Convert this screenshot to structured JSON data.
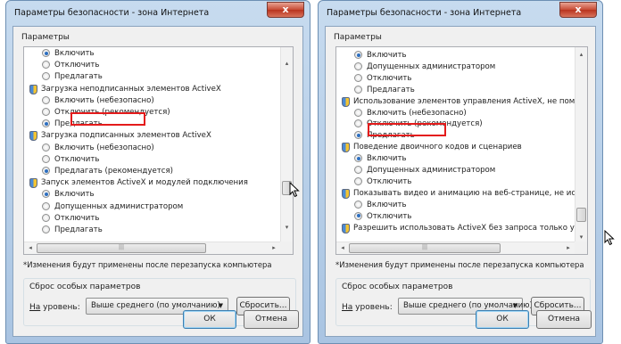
{
  "left_dialog": {
    "title": "Параметры безопасности - зона Интернета",
    "close_label": "x",
    "group_label": "Параметры",
    "items": [
      {
        "kind": "radio",
        "checked": true,
        "label": "Включить"
      },
      {
        "kind": "radio",
        "checked": false,
        "label": "Отключить"
      },
      {
        "kind": "radio",
        "checked": false,
        "label": "Предлагать"
      },
      {
        "kind": "header",
        "label": "Загрузка неподписанных элементов ActiveX"
      },
      {
        "kind": "radio",
        "checked": false,
        "label": "Включить (небезопасно)"
      },
      {
        "kind": "radio",
        "checked": false,
        "label": "Отключить (рекомендуется)"
      },
      {
        "kind": "radio",
        "checked": true,
        "label": "Предлагать"
      },
      {
        "kind": "header",
        "label": "Загрузка подписанных элементов ActiveX"
      },
      {
        "kind": "radio",
        "checked": false,
        "label": "Включить (небезопасно)"
      },
      {
        "kind": "radio",
        "checked": false,
        "label": "Отключить"
      },
      {
        "kind": "radio",
        "checked": true,
        "label": "Предлагать (рекомендуется)"
      },
      {
        "kind": "header",
        "label": "Запуск элементов ActiveX и модулей подключения"
      },
      {
        "kind": "radio",
        "checked": true,
        "label": "Включить"
      },
      {
        "kind": "radio",
        "checked": false,
        "label": "Допущенных администратором"
      },
      {
        "kind": "radio",
        "checked": false,
        "label": "Отключить"
      },
      {
        "kind": "radio",
        "checked": false,
        "label": "Предлагать"
      }
    ],
    "note": "*Изменения будут применены после перезапуска компьютера",
    "reset_group_label": "Сброс особых параметров",
    "level_label_prefix": "На",
    "level_label_rest": " уровень:",
    "level_value": "Выше среднего (по умолчанию)",
    "reset_button": "Сбросить...",
    "ok_button": "ОК",
    "cancel_button": "Отмена"
  },
  "right_dialog": {
    "title": "Параметры безопасности - зона Интернета",
    "close_label": "x",
    "group_label": "Параметры",
    "items": [
      {
        "kind": "radio",
        "checked": true,
        "label": "Включить"
      },
      {
        "kind": "radio",
        "checked": false,
        "label": "Допущенных администратором"
      },
      {
        "kind": "radio",
        "checked": false,
        "label": "Отключить"
      },
      {
        "kind": "radio",
        "checked": false,
        "label": "Предлагать"
      },
      {
        "kind": "header",
        "label": "Использование элементов управления ActiveX, не помече"
      },
      {
        "kind": "radio",
        "checked": false,
        "label": "Включить (небезопасно)"
      },
      {
        "kind": "radio",
        "checked": false,
        "label": "Отключить (рекомендуется)"
      },
      {
        "kind": "radio",
        "checked": true,
        "label": "Предлагать"
      },
      {
        "kind": "header",
        "label": "Поведение двоичного кодов и сценариев"
      },
      {
        "kind": "radio",
        "checked": true,
        "label": "Включить"
      },
      {
        "kind": "radio",
        "checked": false,
        "label": "Допущенных администратором"
      },
      {
        "kind": "radio",
        "checked": false,
        "label": "Отключить"
      },
      {
        "kind": "header",
        "label": "Показывать видео и анимацию на веб-странице, не испо"
      },
      {
        "kind": "radio",
        "checked": false,
        "label": "Включить"
      },
      {
        "kind": "radio",
        "checked": true,
        "label": "Отключить"
      },
      {
        "kind": "header",
        "label": "Разрешить использовать ActiveX без запроса только утв"
      }
    ],
    "note": "*Изменения будут применены после перезапуска компьютера",
    "reset_group_label": "Сброс особых параметров",
    "level_label_prefix": "На",
    "level_label_rest": " уровень:",
    "level_value": "Выше среднего (по умолчанию)",
    "reset_button": "Сбросить...",
    "ok_button": "ОК",
    "cancel_button": "Отмена"
  },
  "colors": {
    "highlight_box": "#e41b1b",
    "radio_dot": "#2d6fc0"
  }
}
